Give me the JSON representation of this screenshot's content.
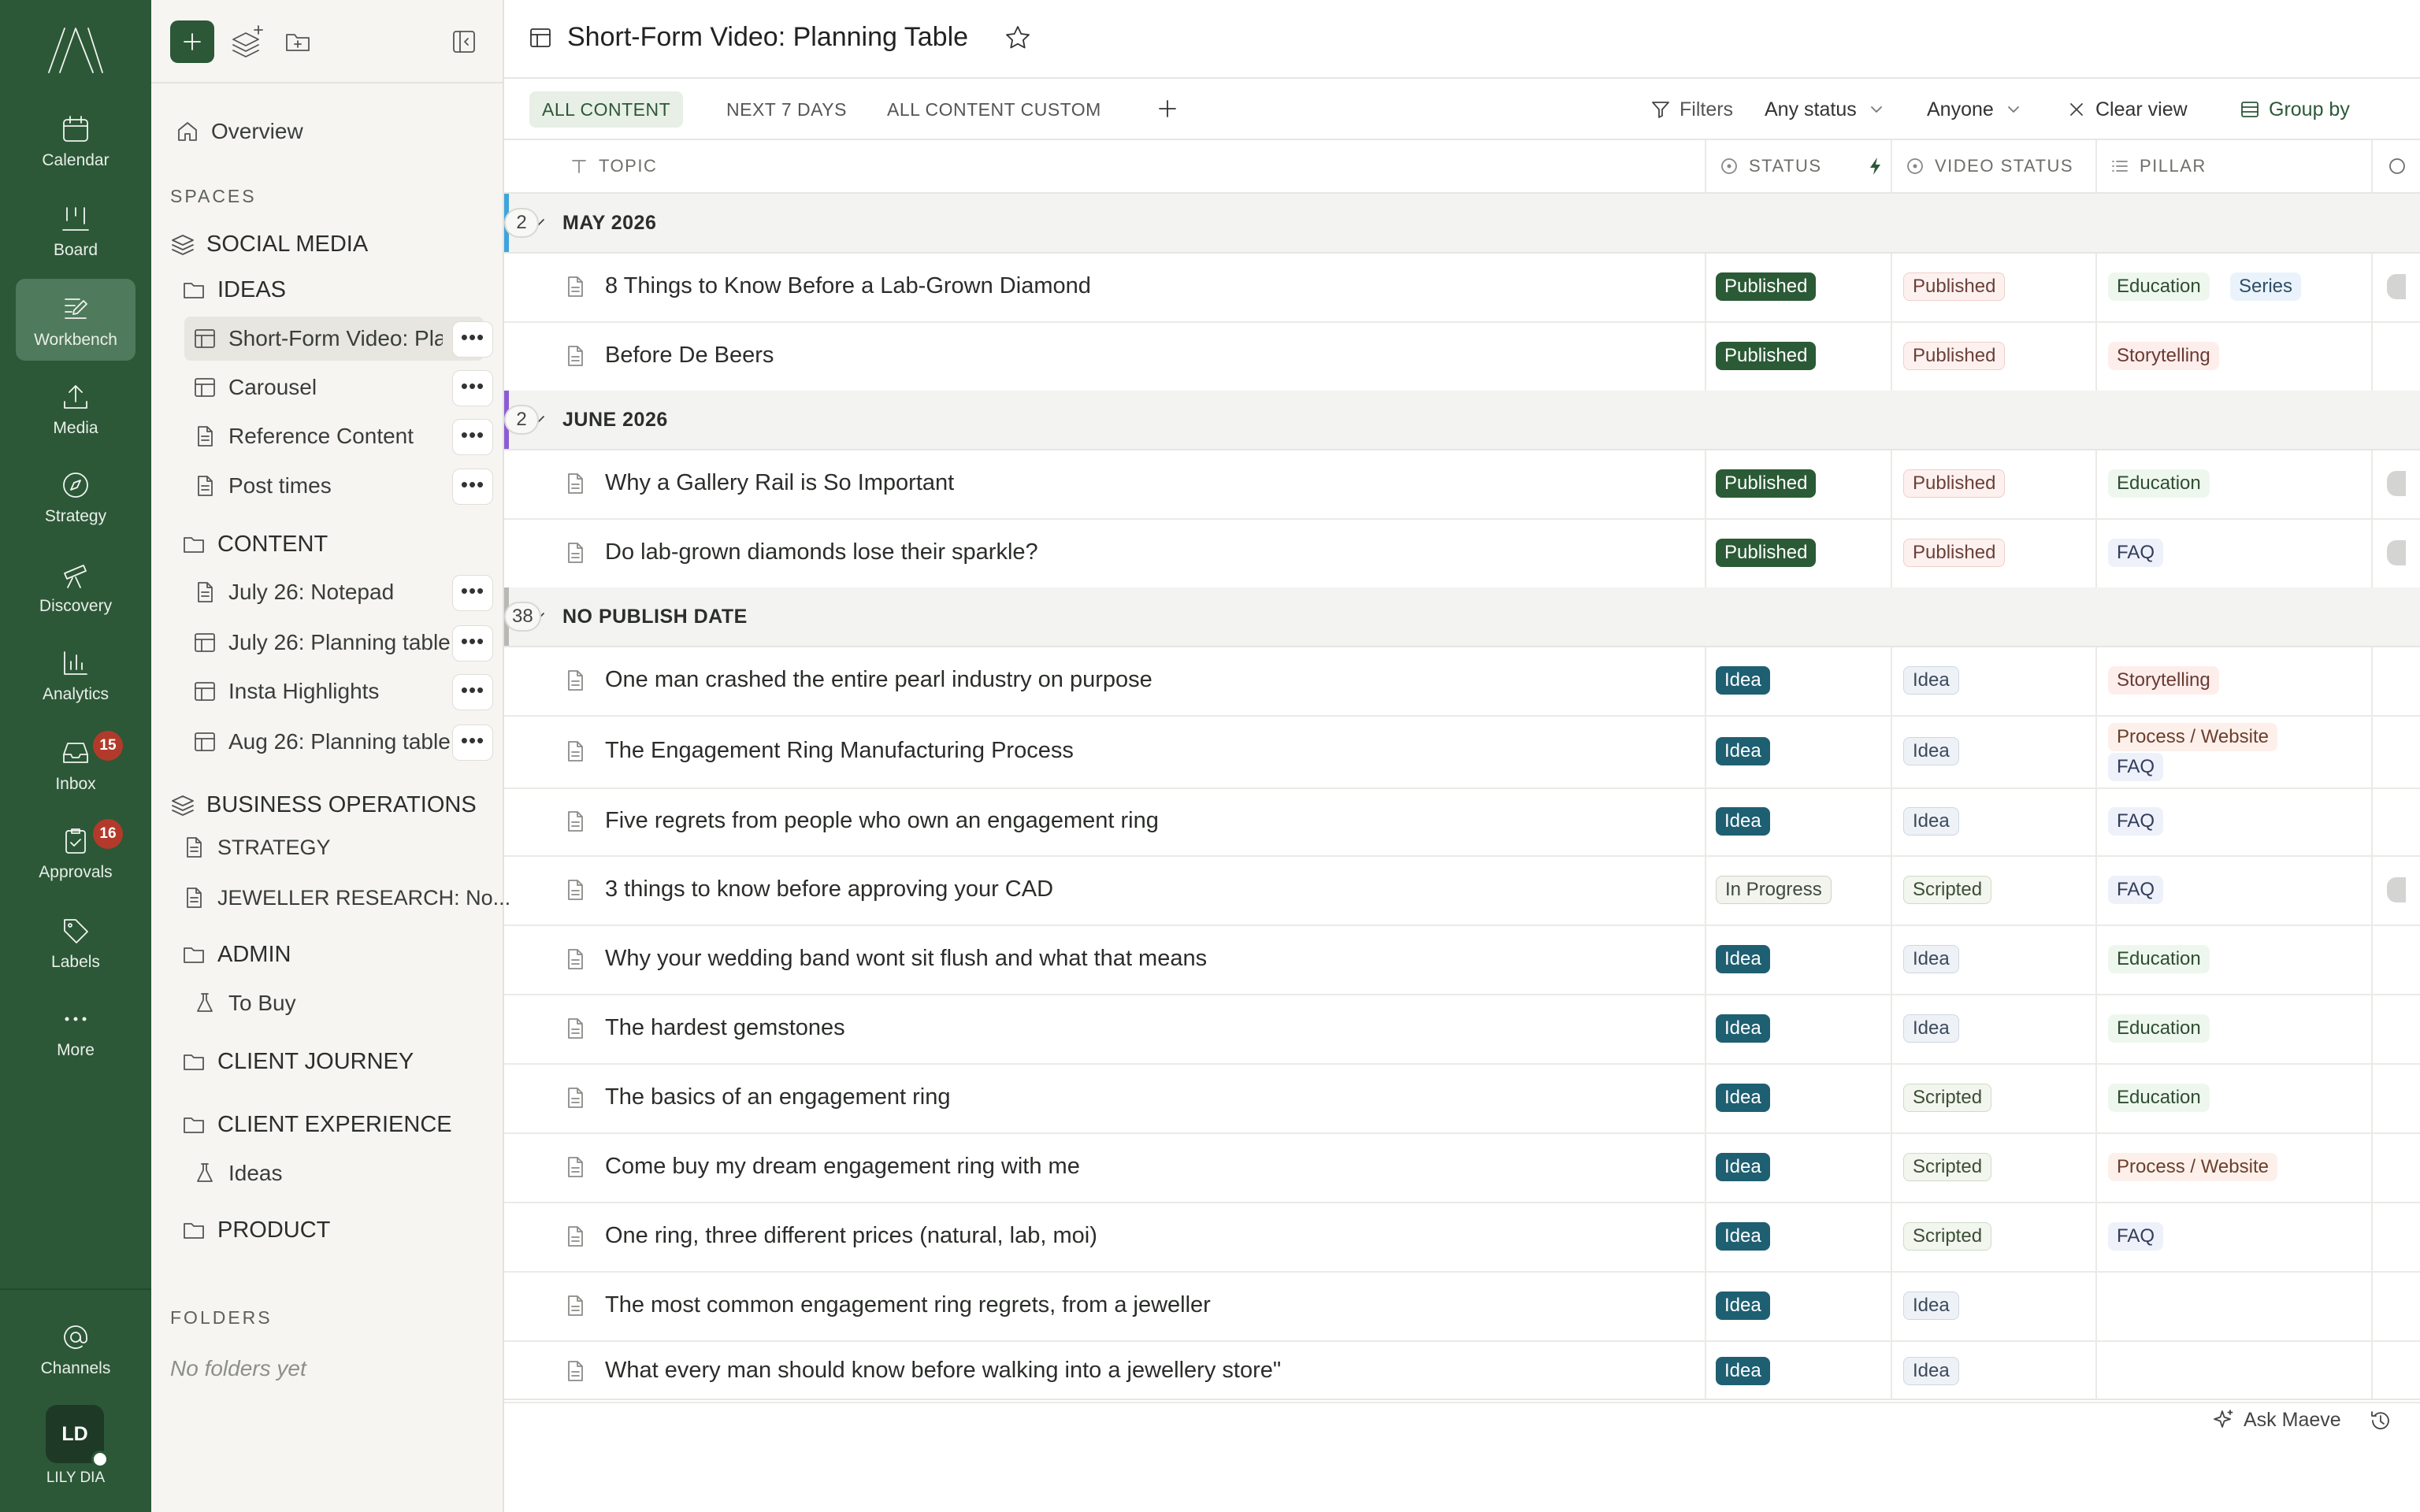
{
  "rail": {
    "logo": "brand-logo",
    "items": [
      {
        "label": "Calendar",
        "icon": "calendar-icon"
      },
      {
        "label": "Board",
        "icon": "board-icon"
      },
      {
        "label": "Workbench",
        "icon": "workbench-icon",
        "active": true
      },
      {
        "label": "Media",
        "icon": "upload-icon"
      },
      {
        "label": "Strategy",
        "icon": "compass-icon"
      },
      {
        "label": "Discovery",
        "icon": "telescope-icon"
      },
      {
        "label": "Analytics",
        "icon": "analytics-icon"
      },
      {
        "label": "Inbox",
        "icon": "inbox-icon",
        "badge": "15"
      },
      {
        "label": "Approvals",
        "icon": "approvals-icon",
        "badge": "16"
      },
      {
        "label": "Labels",
        "icon": "tag-icon"
      },
      {
        "label": "More",
        "icon": "more-icon"
      }
    ],
    "channels_label": "Channels",
    "user": {
      "initials": "LD",
      "name": "LILY DIA"
    }
  },
  "sidebar": {
    "overview": "Overview",
    "spaces_label": "SPACES",
    "social_media": "SOCIAL MEDIA",
    "ideas": "IDEAS",
    "ideas_items": [
      "Short-Form Video: Plan",
      "Carousel",
      "Reference Content",
      "Post times"
    ],
    "content": "CONTENT",
    "content_items": [
      "July 26: Notepad",
      "July 26: Planning table",
      "Insta Highlights",
      "Aug 26: Planning table"
    ],
    "business_operations": "BUSINESS OPERATIONS",
    "strategy": "STRATEGY",
    "jeweller_research": "JEWELLER RESEARCH: No...",
    "admin": "ADMIN",
    "to_buy": "To Buy",
    "client_journey": "CLIENT JOURNEY",
    "client_experience": "CLIENT EXPERIENCE",
    "client_ideas": "Ideas",
    "product": "PRODUCT",
    "folders_label": "FOLDERS",
    "no_folders": "No folders yet",
    "more_glyph": "•••"
  },
  "header": {
    "title": "Short-Form Video: Planning Table"
  },
  "viewbar": {
    "tabs": [
      "ALL CONTENT",
      "NEXT 7 DAYS",
      "ALL CONTENT CUSTOM"
    ],
    "filters": "Filters",
    "status_filter": "Any status",
    "assignee_filter": "Anyone",
    "clear_view": "Clear view",
    "group_by": "Group by"
  },
  "table": {
    "columns": [
      "TOPIC",
      "STATUS",
      "VIDEO STATUS",
      "PILLAR"
    ],
    "groups": [
      {
        "name": "MAY 2026",
        "count": "2",
        "color": "#3da5dc"
      },
      {
        "name": "JUNE 2026",
        "count": "2",
        "color": "#8b5cd6"
      },
      {
        "name": "NO PUBLISH DATE",
        "count": "38",
        "color": "#b8b8b4"
      }
    ],
    "rows": [
      {
        "topic": "8 Things to Know Before a Lab-Grown Diamond",
        "status": "Published",
        "video_status": "Published",
        "pillars": [
          "Education",
          "Series"
        ]
      },
      {
        "topic": "Before De Beers",
        "status": "Published",
        "video_status": "Published",
        "pillars": [
          "Storytelling"
        ]
      },
      {
        "topic": "Why a Gallery Rail is So Important",
        "status": "Published",
        "video_status": "Published",
        "pillars": [
          "Education"
        ]
      },
      {
        "topic": "Do lab-grown diamonds lose their sparkle?",
        "status": "Published",
        "video_status": "Published",
        "pillars": [
          "FAQ"
        ]
      },
      {
        "topic": "One man crashed the entire pearl industry on purpose",
        "status": "Idea",
        "video_status": "Idea",
        "pillars": [
          "Storytelling"
        ]
      },
      {
        "topic": "The Engagement Ring Manufacturing Process",
        "status": "Idea",
        "video_status": "Idea",
        "pillars": [
          "Process / Website",
          "FAQ"
        ]
      },
      {
        "topic": "Five regrets from people who own an engagement ring",
        "status": "Idea",
        "video_status": "Idea",
        "pillars": [
          "FAQ"
        ]
      },
      {
        "topic": "3 things to know before approving your CAD",
        "status": "In Progress",
        "video_status": "Scripted",
        "pillars": [
          "FAQ"
        ]
      },
      {
        "topic": "Why your wedding band wont sit flush and what that means",
        "status": "Idea",
        "video_status": "Idea",
        "pillars": [
          "Education"
        ]
      },
      {
        "topic": "The hardest gemstones",
        "status": "Idea",
        "video_status": "Idea",
        "pillars": [
          "Education"
        ]
      },
      {
        "topic": "The basics of an engagement ring",
        "status": "Idea",
        "video_status": "Scripted",
        "pillars": [
          "Education"
        ]
      },
      {
        "topic": "Come buy my dream engagement ring with me",
        "status": "Idea",
        "video_status": "Scripted",
        "pillars": [
          "Process / Website"
        ]
      },
      {
        "topic": "One ring, three different prices (natural, lab, moi)",
        "status": "Idea",
        "video_status": "Scripted",
        "pillars": [
          "FAQ"
        ]
      },
      {
        "topic": "The most common engagement ring regrets, from a jeweller",
        "status": "Idea",
        "video_status": "Idea",
        "pillars": []
      },
      {
        "topic": "What every man should know before walking into a jewellery store\"",
        "status": "Idea",
        "video_status": "Idea",
        "pillars": []
      }
    ]
  },
  "footer": {
    "ask": "Ask Maeve"
  },
  "colors": {
    "rail": "#2c5837",
    "accent": "#2c5837",
    "idea": "#1f5f72"
  }
}
